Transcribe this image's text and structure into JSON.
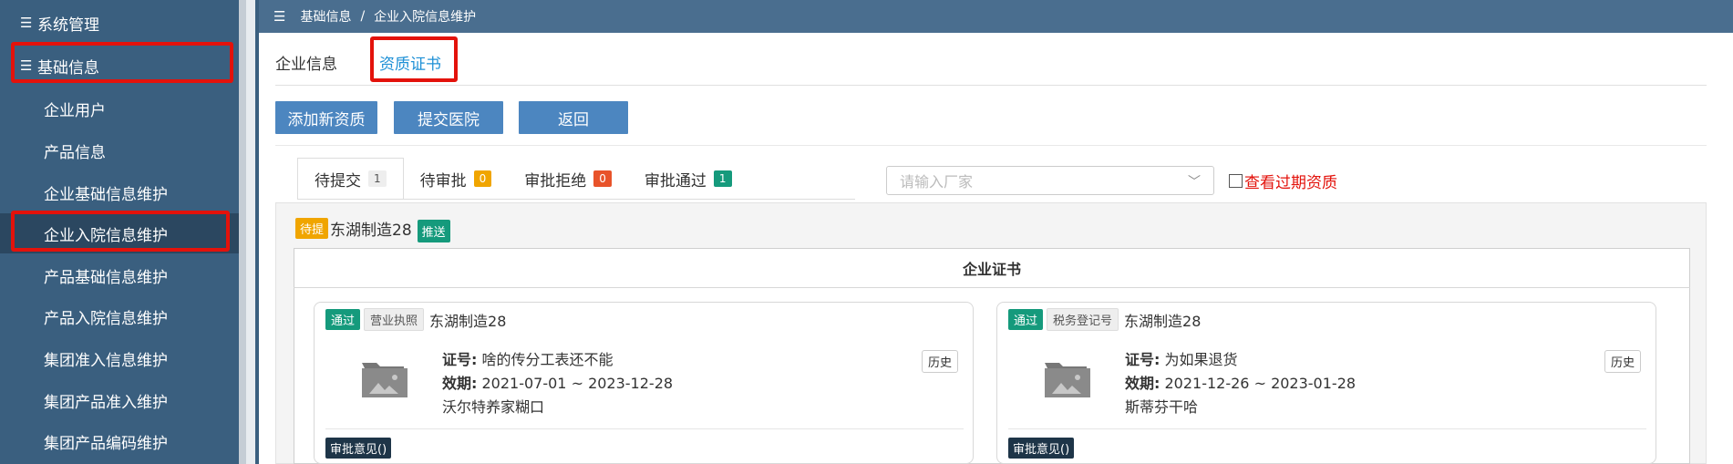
{
  "sidebar": {
    "groups": [
      {
        "label": "系统管理"
      },
      {
        "label": "基础信息"
      }
    ],
    "items": [
      {
        "label": "企业用户"
      },
      {
        "label": "产品信息"
      },
      {
        "label": "企业基础信息维护"
      },
      {
        "label": "企业入院信息维护"
      },
      {
        "label": "产品基础信息维护"
      },
      {
        "label": "产品入院信息维护"
      },
      {
        "label": "集团准入信息维护"
      },
      {
        "label": "集团产品准入维护"
      },
      {
        "label": "集团产品编码维护"
      }
    ]
  },
  "breadcrumb": {
    "root": "基础信息",
    "sep": "/",
    "current": "企业入院信息维护"
  },
  "tabs": [
    {
      "label": "企业信息"
    },
    {
      "label": "资质证书"
    }
  ],
  "buttons": {
    "add": "添加新资质",
    "submit": "提交医院",
    "back": "返回"
  },
  "status_tabs": [
    {
      "label": "待提交",
      "count": "1",
      "color": "#eeeeee"
    },
    {
      "label": "待审批",
      "count": "0",
      "color": "#f0a500"
    },
    {
      "label": "审批拒绝",
      "count": "0",
      "color": "#e8532a"
    },
    {
      "label": "审批通过",
      "count": "1",
      "color": "#159a7c"
    }
  ],
  "filter": {
    "placeholder": "请输入厂家",
    "expired_label": "查看过期资质"
  },
  "group": {
    "status": "待提",
    "name": "东湖制造28",
    "push": "推送"
  },
  "cert_section_title": "企业证书",
  "cards": [
    {
      "status": "通过",
      "type": "营业执照",
      "company": "东湖制造28",
      "number_label": "证号:",
      "number": "啥的传分工表还不能",
      "validity_label": "效期:",
      "validity": "2021-07-01 ~ 2023-12-28",
      "note": "沃尔特养家糊口",
      "history": "历史",
      "opinion": "审批意见()"
    },
    {
      "status": "通过",
      "type": "税务登记号",
      "company": "东湖制造28",
      "number_label": "证号:",
      "number": "为如果退货",
      "validity_label": "效期:",
      "validity": "2021-12-26 ~ 2023-01-28",
      "note": "斯蒂芬干哈",
      "history": "历史",
      "opinion": "审批意见()"
    }
  ],
  "colors": {
    "sidebar": "#3a5f7f",
    "topbar": "#4a6e8f",
    "button": "#4c86c0",
    "highlight": "#e3120b",
    "active_tab": "#1e90d6"
  }
}
